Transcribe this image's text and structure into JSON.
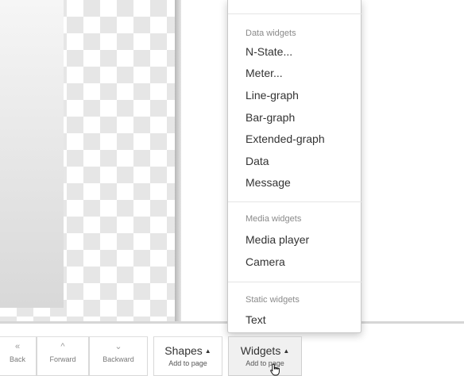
{
  "canvas": {
    "background_pattern": "checkerboard",
    "checker_color": "#e6e6e6"
  },
  "dropdown": {
    "sections": [
      {
        "header": "Data widgets",
        "items": [
          "N-State...",
          "Meter...",
          "Line-graph",
          "Bar-graph",
          "Extended-graph",
          "Data",
          "Message"
        ]
      },
      {
        "header": "Media widgets",
        "items": [
          "Media player",
          "Camera"
        ]
      },
      {
        "header": "Static widgets",
        "items": [
          "Text"
        ]
      }
    ]
  },
  "toolbar": {
    "back": {
      "label": "Back",
      "icon": "double-chevron-down-icon"
    },
    "forward": {
      "label": "Forward",
      "icon": "chevron-up-icon"
    },
    "backward": {
      "label": "Backward",
      "icon": "chevron-down-icon"
    },
    "shapes": {
      "label": "Shapes",
      "sublabel": "Add to page",
      "caret": "▲"
    },
    "widgets": {
      "label": "Widgets",
      "sublabel": "Add to page",
      "caret": "▲"
    }
  }
}
